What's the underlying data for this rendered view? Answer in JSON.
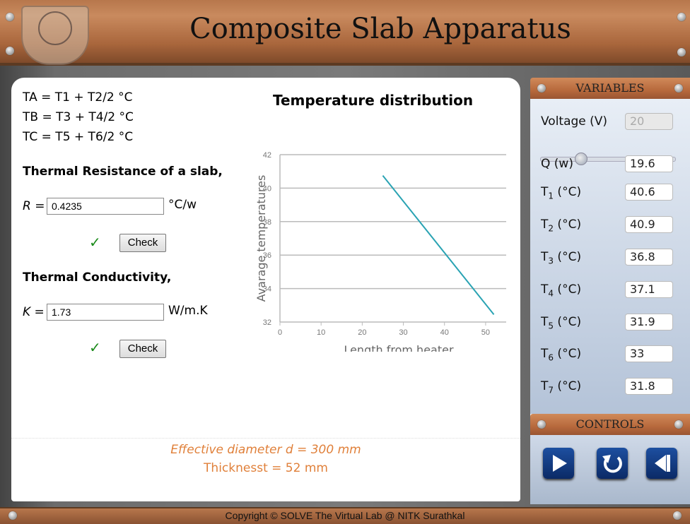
{
  "app": {
    "title": "Composite Slab Apparatus"
  },
  "formulas": [
    "TA = T1 + T2/2 °C",
    "TB = T3 + T4/2 °C",
    "TC = T5 + T6/2 °C"
  ],
  "resistance": {
    "heading": "Thermal Resistance of a slab,",
    "label": "R =",
    "value": "0.4235",
    "unit": "°C/w",
    "check_mark": "✓",
    "check_label": "Check"
  },
  "conductivity": {
    "heading": "Thermal Conductivity,",
    "label": "K =",
    "value": "1.73",
    "unit": "W/m.K",
    "check_mark": "✓",
    "check_label": "Check"
  },
  "chart_title": "Temperature distribution",
  "chart_data": {
    "type": "line",
    "title": "Temperature distribution",
    "xlabel": "Length from heater",
    "ylabel": "Avarage temperatures",
    "xlim": [
      0,
      55
    ],
    "ylim": [
      32,
      42
    ],
    "x_ticks": [
      0,
      10,
      20,
      30,
      40,
      50
    ],
    "y_ticks": [
      32,
      34,
      36,
      38,
      40,
      42
    ],
    "grid": true,
    "series": [
      {
        "color": "#2aa3b3",
        "x": [
          25,
          52
        ],
        "y": [
          40.75,
          32.45
        ]
      }
    ]
  },
  "notes": {
    "diameter": "Effective diameter d = 300 mm",
    "thickness": "Thicknesst = 52 mm"
  },
  "variables": {
    "header": "VARIABLES",
    "voltage_label": "Voltage (V)",
    "voltage_value": "20",
    "voltage_slider_fraction": 0.3,
    "q_label": "Q (w)",
    "q_value": "19.6",
    "temps": [
      {
        "name": "T",
        "sub": "1",
        "unit": " (°C)",
        "value": "40.6"
      },
      {
        "name": "T",
        "sub": "2",
        "unit": " (°C)",
        "value": "40.9"
      },
      {
        "name": "T",
        "sub": "3",
        "unit": " (°C)",
        "value": "36.8"
      },
      {
        "name": "T",
        "sub": "4",
        "unit": " (°C)",
        "value": "37.1"
      },
      {
        "name": "T",
        "sub": "5",
        "unit": " (°C)",
        "value": "31.9"
      },
      {
        "name": "T",
        "sub": "6",
        "unit": " (°C)",
        "value": "33"
      },
      {
        "name": "T",
        "sub": "7",
        "unit": " (°C)",
        "value": "31.8"
      }
    ]
  },
  "controls": {
    "header": "CONTROLS",
    "buttons": [
      "play-icon",
      "reset-icon",
      "step-back-icon"
    ]
  },
  "footer": {
    "copyright": "Copyright © SOLVE The Virtual Lab @ NITK Surathkal"
  },
  "colors": {
    "accent": "#2aa3b3",
    "note": "#e0803a",
    "panel_header": "#b7693c",
    "button": "#0b2a66"
  }
}
